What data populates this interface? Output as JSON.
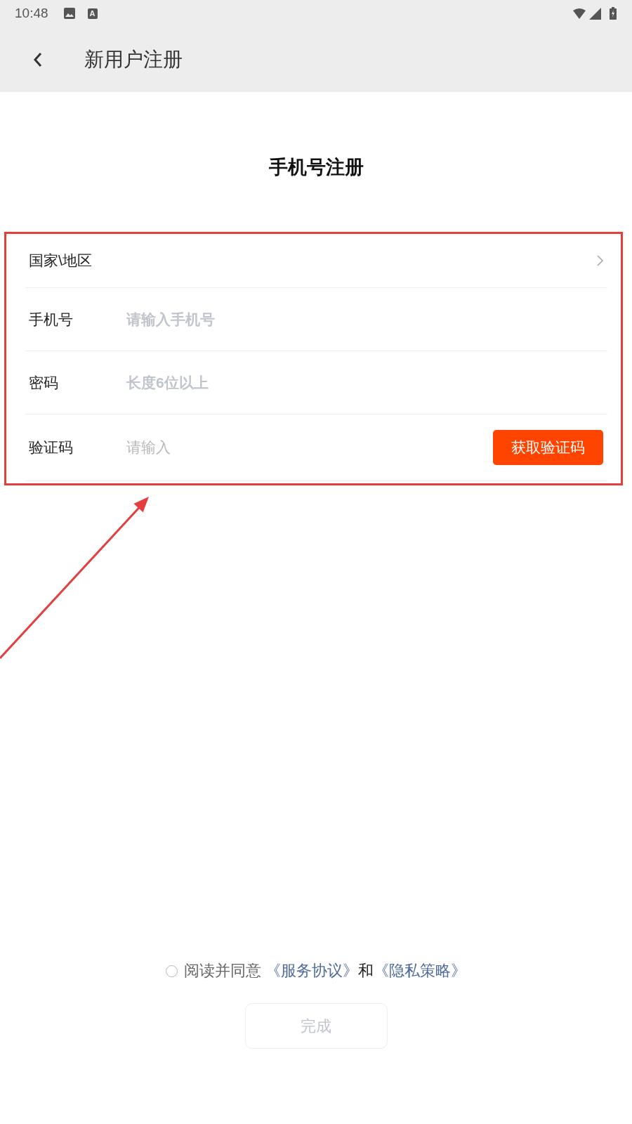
{
  "status_bar": {
    "time": "10:48",
    "app_icon_letter": "A"
  },
  "header": {
    "title": "新用户注册"
  },
  "page_title": "手机号注册",
  "form": {
    "rows": [
      {
        "kind": "select",
        "label": "国家\\地区"
      },
      {
        "kind": "input",
        "label": "手机号",
        "placeholder": "请输入手机号",
        "placeholder_bold": true
      },
      {
        "kind": "input",
        "label": "密码",
        "placeholder": "长度6位以上",
        "placeholder_bold": true
      },
      {
        "kind": "code",
        "label": "验证码",
        "placeholder": "请输入",
        "placeholder_bold": false,
        "button": "获取验证码"
      }
    ]
  },
  "agreement": {
    "checked": false,
    "text": "阅读并同意",
    "link_1": "《服务协议》",
    "joiner": "和",
    "link_2": "《隐私策略》"
  },
  "submit": {
    "label": "完成",
    "disabled": true
  }
}
